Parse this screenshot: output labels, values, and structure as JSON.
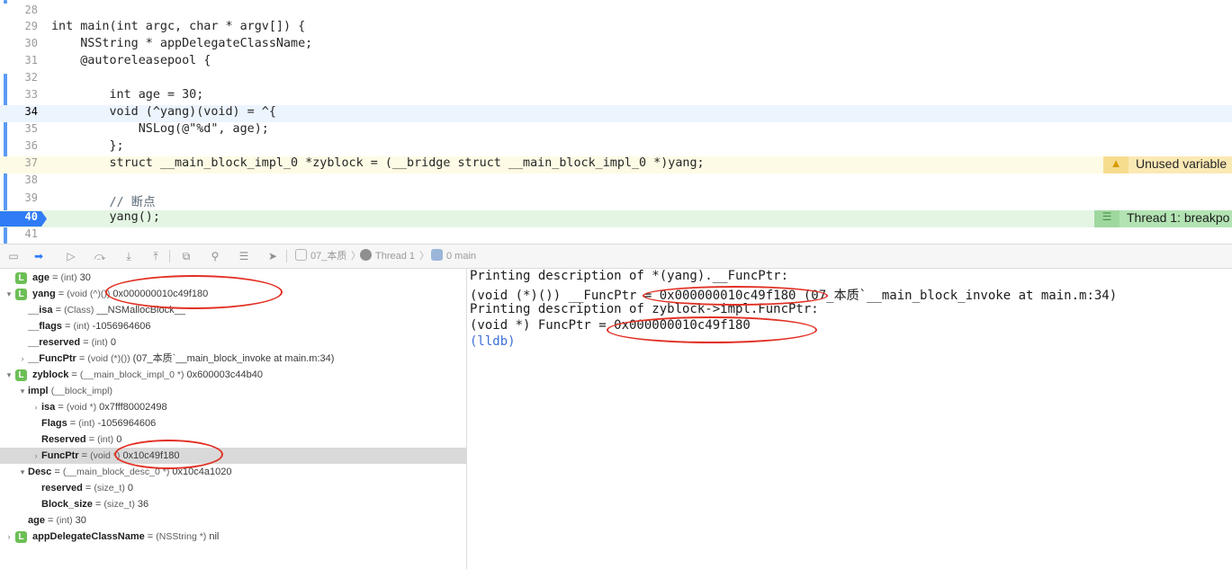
{
  "editor": {
    "lines": [
      {
        "num": "28",
        "code": ""
      },
      {
        "num": "29",
        "code": "int main(int argc, char * argv[]) {"
      },
      {
        "num": "30",
        "code": "    NSString * appDelegateClassName;"
      },
      {
        "num": "31",
        "code": "    @autoreleasepool {"
      },
      {
        "num": "32",
        "code": ""
      },
      {
        "num": "33",
        "code": "        int age = 30;"
      },
      {
        "num": "34",
        "code": "        void (^yang)(void) = ^{"
      },
      {
        "num": "35",
        "code": "            NSLog(@\"%d\", age);"
      },
      {
        "num": "36",
        "code": "        };"
      },
      {
        "num": "37",
        "code": "        struct __main_block_impl_0 *zyblock = (__bridge struct __main_block_impl_0 *)yang;"
      },
      {
        "num": "38",
        "code": ""
      },
      {
        "num": "39",
        "code": "        // 断点"
      },
      {
        "num": "40",
        "code": "        yang();"
      },
      {
        "num": "41",
        "code": ""
      }
    ],
    "warning": {
      "icon": "warning-triangle-icon",
      "text": "Unused variable"
    },
    "thread_issue": {
      "icon": "thread-lines-icon",
      "text": "Thread 1: breakpo"
    }
  },
  "debugbar": {
    "crumbs": [
      "07_本质",
      "Thread 1",
      "0 main"
    ],
    "accent": "#2f7cf6"
  },
  "variables": [
    {
      "name": "age",
      "type": "(int)",
      "value": "30"
    },
    {
      "name": "yang",
      "type": "(void (^)())",
      "value": "0x000000010c49f180"
    },
    {
      "name": "__isa",
      "type": "(Class)",
      "value": "__NSMallocBlock__"
    },
    {
      "name": "__flags",
      "type": "(int)",
      "value": "-1056964606"
    },
    {
      "name": "__reserved",
      "type": "(int)",
      "value": "0"
    },
    {
      "name": "__FuncPtr",
      "type": "(void (*)())",
      "value": "(07_本质`__main_block_invoke at main.m:34)"
    },
    {
      "name": "zyblock",
      "type": "(__main_block_impl_0 *)",
      "value": "0x600003c44b40"
    },
    {
      "name": "impl",
      "type": "(__block_impl)",
      "value": ""
    },
    {
      "name": "isa",
      "type": "(void *)",
      "value": "0x7fff80002498"
    },
    {
      "name": "Flags",
      "type": "(int)",
      "value": "-1056964606"
    },
    {
      "name": "Reserved",
      "type": "(int)",
      "value": "0"
    },
    {
      "name": "FuncPtr",
      "type": "(void *)",
      "value": "0x10c49f180"
    },
    {
      "name": "Desc",
      "type": "(__main_block_desc_0 *)",
      "value": "0x10c4a1020"
    },
    {
      "name": "reserved",
      "type": "(size_t)",
      "value": "0"
    },
    {
      "name": "Block_size",
      "type": "(size_t)",
      "value": "36"
    },
    {
      "name": "age",
      "type": "(int)",
      "value": "30"
    },
    {
      "name": "appDelegateClassName",
      "type": "(NSString *)",
      "value": "nil"
    }
  ],
  "console": {
    "lines": [
      "Printing description of *(yang).__FuncPtr:",
      "(void (*)()) __FuncPtr = 0x000000010c49f180 (07_本质`__main_block_invoke at main.m:34)",
      "Printing description of zyblock->impl.FuncPtr:",
      "(void *) FuncPtr = 0x000000010c49f180",
      "(lldb)"
    ]
  },
  "colors": {
    "annotation": "#e23024",
    "current_line": "#e4f5e4",
    "warning_bg": "#fbe9b4",
    "breakpoint": "#2f7cf6"
  }
}
